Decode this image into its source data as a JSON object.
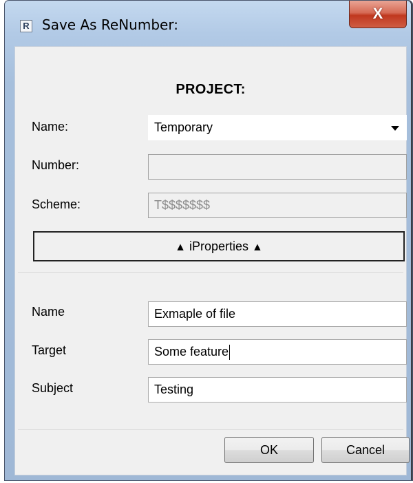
{
  "window": {
    "title": "Save As ReNumber:",
    "icon_letter": "R",
    "close_glyph": "X"
  },
  "project": {
    "heading": "PROJECT:",
    "name_label": "Name:",
    "name_value": "Temporary",
    "number_label": "Number:",
    "number_value": "",
    "scheme_label": "Scheme:",
    "scheme_value": "T$$$$$$$",
    "iproperties_label": "iProperties"
  },
  "iproperties": {
    "name_label": "Name",
    "name_value": "Exmaple of file",
    "target_label": "Target",
    "target_value": "Some feature",
    "subject_label": "Subject",
    "subject_value": "Testing"
  },
  "buttons": {
    "ok": "OK",
    "cancel": "Cancel"
  }
}
